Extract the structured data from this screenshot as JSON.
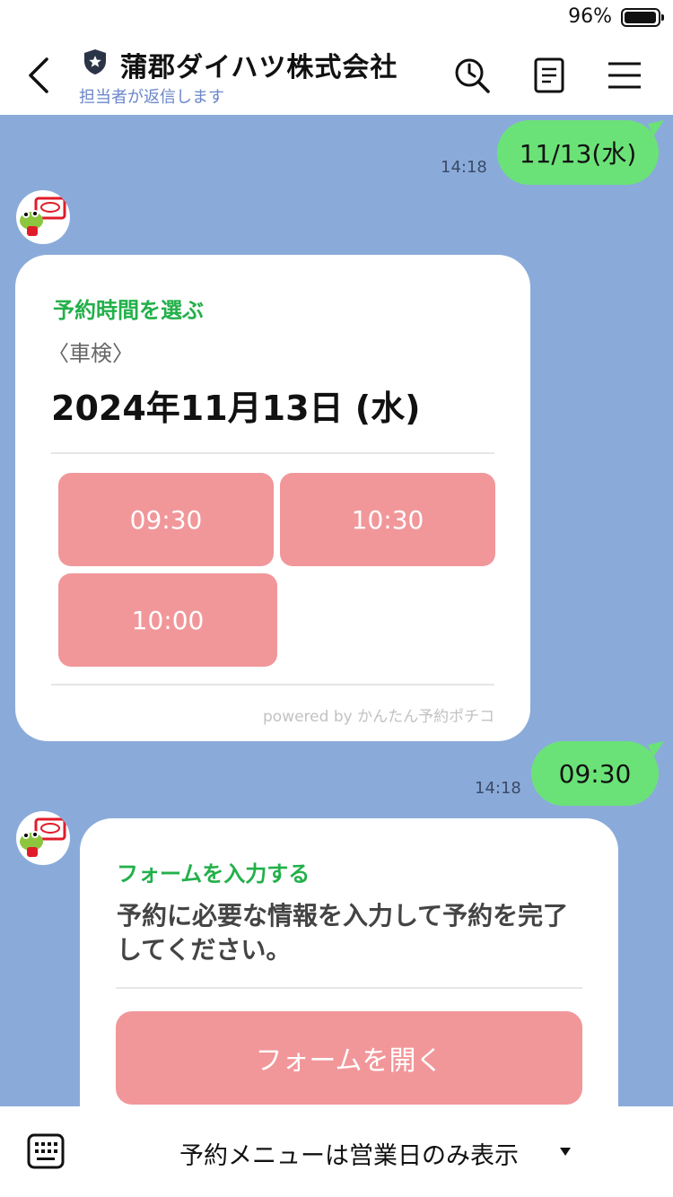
{
  "status": {
    "battery": "96%"
  },
  "header": {
    "title": "蒲郡ダイハツ株式会社",
    "subtitle": "担当者が返信します",
    "icons": [
      "back-icon",
      "shield-icon",
      "search-clock-icon",
      "notes-icon",
      "menu-icon"
    ]
  },
  "messages": {
    "m1": {
      "text": "11/13(水)",
      "time": "14:18"
    },
    "card1": {
      "heading": "予約時間を選ぶ",
      "category": "〈車検〉",
      "date": "2024年11月13日 (水)",
      "slots": [
        "09:30",
        "10:30",
        "10:00"
      ],
      "powered_by": "powered by かんたん予約ポチコ"
    },
    "m2": {
      "text": "09:30",
      "time": "14:18"
    },
    "card2": {
      "heading": "フォームを入力する",
      "body": "予約に必要な情報を入力して予約を完了してください。",
      "button": "フォームを開く"
    }
  },
  "footer": {
    "menu_label": "予約メニューは営業日のみ表示"
  },
  "colors": {
    "chat_bg": "#8aabda",
    "outgoing_bubble": "#6be277",
    "slot_button": "#f1979a",
    "heading_green": "#22b04a",
    "subtitle_blue": "#6a86c8"
  }
}
